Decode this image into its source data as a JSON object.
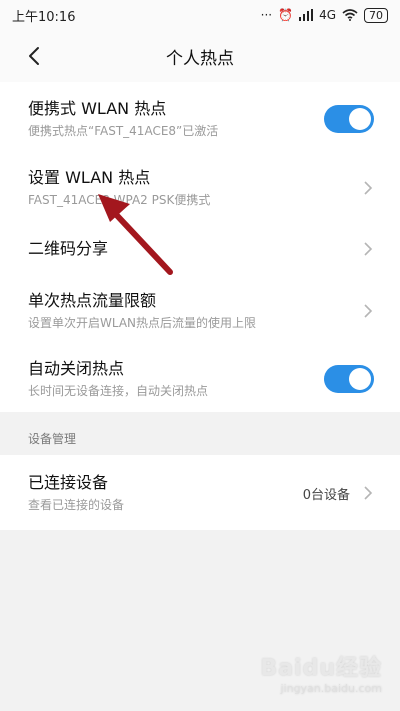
{
  "statusbar": {
    "time": "上午10:16",
    "signal_text": "4G",
    "battery": "70"
  },
  "header": {
    "title": "个人热点"
  },
  "settings": [
    {
      "title": "便携式 WLAN 热点",
      "subtitle": "便携式热点“FAST_41ACE8”已激活",
      "control": "toggle",
      "on": true
    },
    {
      "title": "设置 WLAN 热点",
      "subtitle": "FAST_41ACE8 WPA2 PSK便携式",
      "control": "chevron"
    },
    {
      "title": "二维码分享",
      "subtitle": "",
      "control": "chevron"
    },
    {
      "title": "单次热点流量限额",
      "subtitle": "设置单次开启WLAN热点后流量的使用上限",
      "control": "chevron"
    },
    {
      "title": "自动关闭热点",
      "subtitle": "长时间无设备连接，自动关闭热点",
      "control": "toggle",
      "on": true
    }
  ],
  "device_section": {
    "label": "设备管理",
    "item": {
      "title": "已连接设备",
      "subtitle": "查看已连接的设备",
      "value": "0台设备"
    }
  },
  "watermark": {
    "logo": "Baidu经验",
    "url": "jingyan.baidu.com"
  },
  "colors": {
    "toggle_on": "#2b8fe6",
    "annotation_arrow": "#a3171e"
  }
}
